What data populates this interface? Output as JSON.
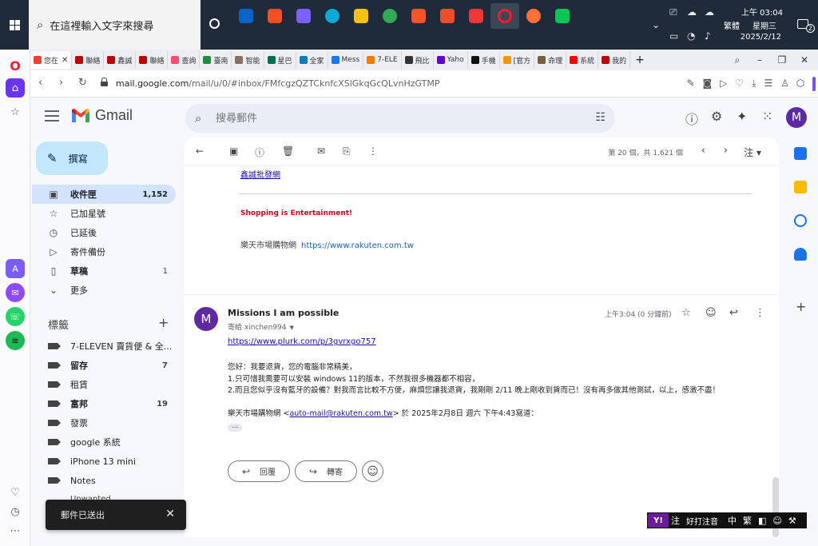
{
  "taskbar": {
    "search_placeholder": "在這裡輸入文字來搜尋",
    "ime_lang": "繁體",
    "time": "上午 03:04",
    "weekday": "星期三",
    "date": "2025/2/12",
    "notification_count": "2"
  },
  "browser": {
    "tabs": [
      {
        "label": "您在 ",
        "color": "#ea4335"
      },
      {
        "label": "聯絡",
        "color": "#bf0000"
      },
      {
        "label": "鑫誠",
        "color": "#bf0000"
      },
      {
        "label": "聯絡",
        "color": "#bf0000"
      },
      {
        "label": "查詢",
        "color": "#ff4d6d"
      },
      {
        "label": "臺南",
        "color": "#1e8e3e"
      },
      {
        "label": "智能",
        "color": "#8d6e63"
      },
      {
        "label": "星巴",
        "color": "#00704a"
      },
      {
        "label": "全家",
        "color": "#0a7cc1"
      },
      {
        "label": "Mess",
        "color": "#1877f2"
      },
      {
        "label": "7-ELE",
        "color": "#f57c00"
      },
      {
        "label": "飛比",
        "color": "#333333"
      },
      {
        "label": "Yaho",
        "color": "#6001d2"
      },
      {
        "label": "手機",
        "color": "#111111"
      },
      {
        "label": "[官方",
        "color": "#f29900"
      },
      {
        "label": "命理",
        "color": "#7b5e3b"
      },
      {
        "label": "系統",
        "color": "#ff0000"
      },
      {
        "label": "我的",
        "color": "#bf0000"
      }
    ],
    "url_host": "mail.google.com",
    "url_path": "/mail/u/0/#inbox/FMfcgzQZTCknfcXSlGkqGcQLvnHzGTMP"
  },
  "gmail": {
    "logo_text": "Gmail",
    "search_placeholder": "搜尋郵件",
    "avatar_letter": "M",
    "compose_label": "撰寫",
    "nav": [
      {
        "label": "收件匣",
        "count": "1,152",
        "icon": "inbox-icon",
        "glyph": "▣",
        "active": true
      },
      {
        "label": "已加星號",
        "count": "",
        "icon": "star-icon",
        "glyph": "☆"
      },
      {
        "label": "已延後",
        "count": "",
        "icon": "clock-icon",
        "glyph": "◷"
      },
      {
        "label": "寄件備份",
        "count": "",
        "icon": "send-icon",
        "glyph": "▷"
      },
      {
        "label": "草稿",
        "count": "1",
        "icon": "draft-icon",
        "glyph": "▯",
        "bold": true
      },
      {
        "label": "更多",
        "count": "",
        "icon": "chevron-down-icon",
        "glyph": "⌄"
      }
    ],
    "labels_heading": "標籤",
    "labels": [
      {
        "label": "7-ELEVEN 賣貨便 & 全...",
        "count": ""
      },
      {
        "label": "留存",
        "count": "7",
        "bold": true
      },
      {
        "label": "租賃",
        "count": ""
      },
      {
        "label": "富邦",
        "count": "19",
        "bold": true
      },
      {
        "label": "發票",
        "count": ""
      },
      {
        "label": "google 系統",
        "count": ""
      },
      {
        "label": "iPhone 13 mini",
        "count": ""
      },
      {
        "label": "Notes",
        "count": ""
      }
    ],
    "label_partial": "Unwanted",
    "pager": "第 20 個，共 1,621 個",
    "input_lang": "注",
    "prev_message": {
      "link": "鑫誠批發網",
      "slogan": "Shopping is Entertainment!",
      "footer_text": "樂天市場購物網",
      "footer_link": "https://www.rakuten.com.tw"
    },
    "message": {
      "sender_initial": "M",
      "subject": "Missions I am possible",
      "to": "寄給 xinchen994",
      "time": "上午3:04 (0 分鐘前)",
      "link": "https://www.plurk.com/p/3gvrxgo757",
      "lines": [
        "您好：我要退貨，您的電腦非常精美，",
        "1.只可惜我需要可以安裝 windows 11的版本，不然我很多機器都不相容，",
        "2.而且您似乎沒有藍牙的設備？對我而言比較不方便，麻煩您讓我退貨，我剛剛 2/11 晚上剛收到貨而已！沒有再多做其他測試，以上，感激不盡！"
      ],
      "quote_prefix": "樂天市場購物網 <",
      "quote_email": "auto-mail@rakuten.com.tw",
      "quote_suffix": "> 於 2025年2月8日 週六 下午4:43寫道："
    },
    "reply_label": "回覆",
    "forward_label": "轉寄",
    "snackbar": "郵件已送出"
  },
  "ime": {
    "mode": "注",
    "name": "好打注音",
    "lang": "中",
    "script": "繁"
  }
}
